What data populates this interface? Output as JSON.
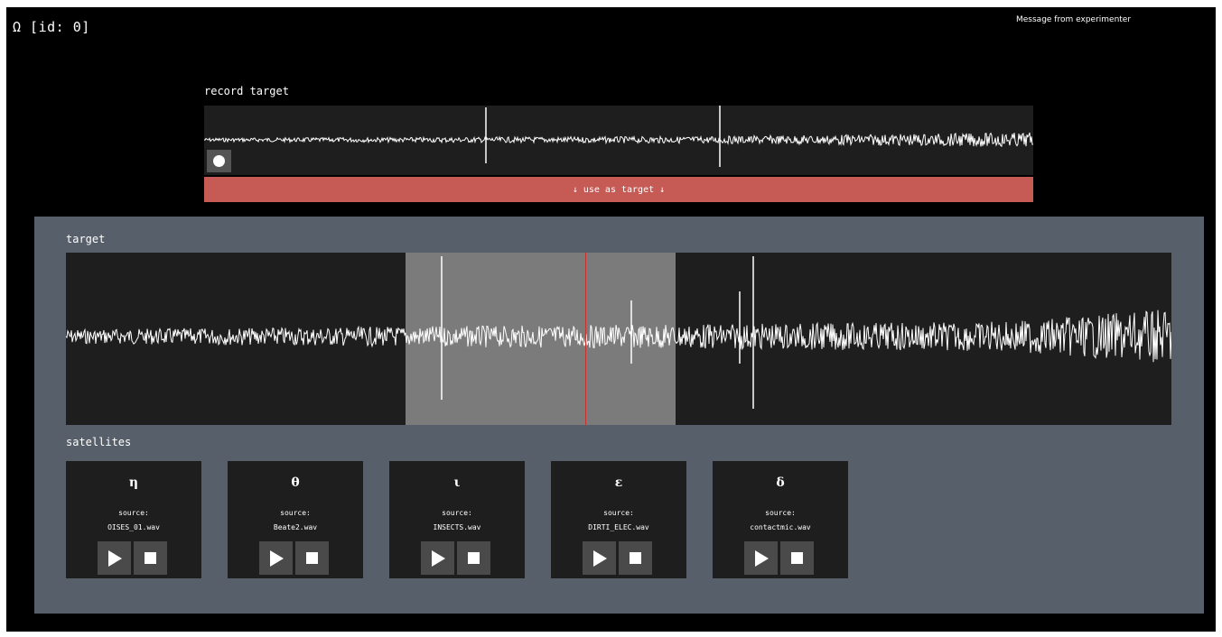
{
  "header": {
    "session_id": "Ω [id: 0]"
  },
  "message": "Message from experimenter",
  "record": {
    "label": "record target",
    "use_button": "↓ use as target ↓"
  },
  "target": {
    "label": "target"
  },
  "satellites": {
    "label": "satellites",
    "source_label": "source:",
    "items": [
      {
        "symbol": "η",
        "file": "OISES_01.wav"
      },
      {
        "symbol": "θ",
        "file": "Beate2.wav"
      },
      {
        "symbol": "ι",
        "file": "INSECTS.wav"
      },
      {
        "symbol": "ε",
        "file": "DIRTI_ELEC.wav"
      },
      {
        "symbol": "δ",
        "file": "contactmic.wav"
      }
    ]
  },
  "colors": {
    "background": "#000000",
    "panel": "#575f6a",
    "waveform_bg": "#1e1e1e",
    "selection": "#7b7b7b",
    "playhead": "#d0302a",
    "use_button": "#c65a55"
  }
}
